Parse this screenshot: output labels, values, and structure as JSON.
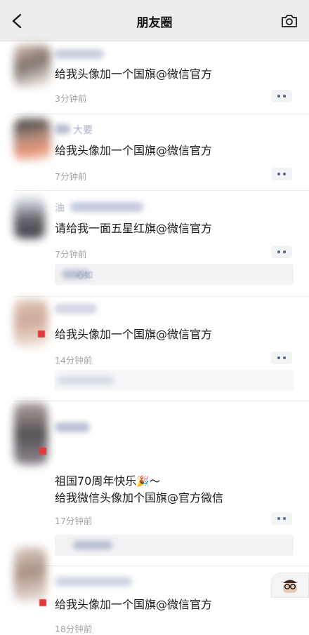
{
  "header": {
    "title": "朋友圈",
    "back_icon": "chevron-left-icon",
    "camera_icon": "camera-icon"
  },
  "posts": [
    {
      "name": "",
      "content": "给我头像加一个国旗@微信官方",
      "time": "3分钟前"
    },
    {
      "name": "大要",
      "content": "给我头像加一个国旗@微信官方",
      "time": "7分钟前"
    },
    {
      "name": "油",
      "content": "请给我一面五星红旗@微信官方",
      "time": "7分钟前",
      "comment": "心如"
    },
    {
      "name": "",
      "content": "给我头像加一个国旗@微信官方",
      "time": "14分钟前"
    },
    {
      "name": "",
      "content_line1": "祖国70周年快乐",
      "content_emoji": "🎉～",
      "content_line2": "给我微信头像加个国旗@官方微信",
      "time": "17分钟前"
    },
    {
      "name": "",
      "content": "给我头像加一个国旗@微信官方",
      "time": "18分钟前"
    }
  ],
  "colors": {
    "header_bg": "#ededed",
    "link_blue": "#56688f",
    "time_gray": "#a3a3a3",
    "flag_red": "#e03a3a"
  }
}
